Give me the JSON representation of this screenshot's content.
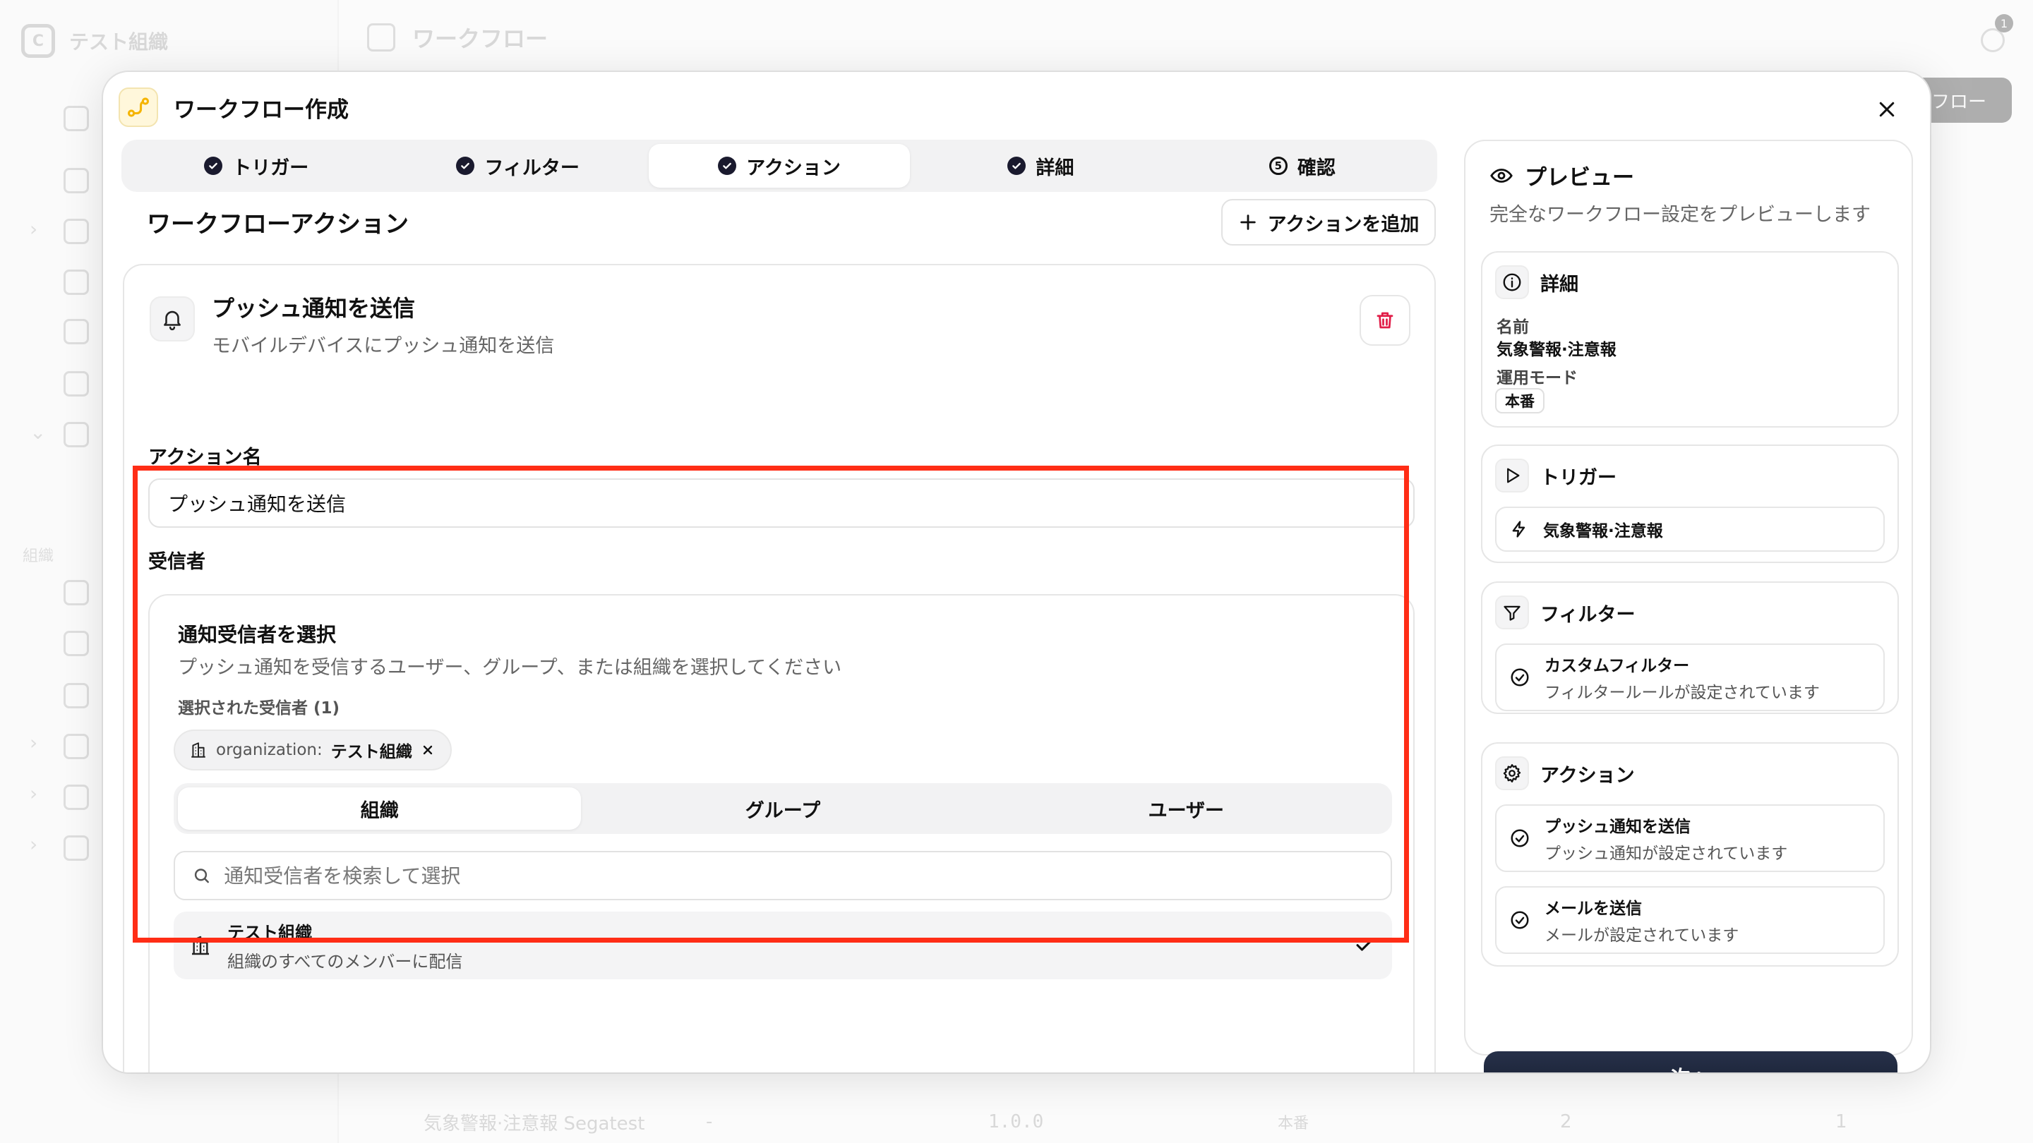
{
  "background": {
    "org_name": "テスト組織",
    "header_title": "ワークフロー",
    "section_label": "組織",
    "top_button": "フロー",
    "badge_count": "1",
    "row": {
      "name": "気象警報·注意報 Segatest",
      "dash": "-",
      "version": "1.0.0",
      "mode": "本番",
      "count_a": "2",
      "count_b": "1"
    }
  },
  "modal": {
    "title": "ワークフロー作成",
    "steps": [
      {
        "label": "トリガー",
        "state": "done"
      },
      {
        "label": "フィルター",
        "state": "done"
      },
      {
        "label": "アクション",
        "state": "done",
        "active": true
      },
      {
        "label": "詳細",
        "state": "done"
      },
      {
        "label": "確認",
        "number": "5"
      }
    ]
  },
  "actions_section": {
    "title": "ワークフローアクション",
    "add_button": "アクションを追加",
    "action": {
      "title": "プッシュ通知を送信",
      "description": "モバイルデバイスにプッシュ通知を送信",
      "name_label": "アクション名",
      "name_value": "プッシュ通知を送信",
      "recipients_label": "受信者",
      "recipients": {
        "title": "通知受信者を選択",
        "description": "プッシュ通知を受信するユーザー、グループ、または組織を選択してください",
        "selected_label": "選択された受信者 (1)",
        "chip_type": "organization:",
        "chip_name": "テスト組織",
        "tabs": [
          "組織",
          "グループ",
          "ユーザー"
        ],
        "active_tab": "組織",
        "search_placeholder": "通知受信者を検索して選択",
        "result": {
          "title": "テスト組織",
          "description": "組織のすべてのメンバーに配信",
          "selected": true
        }
      }
    }
  },
  "preview": {
    "title": "プレビュー",
    "subtitle": "完全なワークフロー設定をプレビューします",
    "details": {
      "title": "詳細",
      "name_label": "名前",
      "name_value": "気象警報·注意報",
      "mode_label": "運用モード",
      "mode_value": "本番"
    },
    "trigger": {
      "title": "トリガー",
      "item": "気象警報·注意報"
    },
    "filter": {
      "title": "フィルター",
      "item_title": "カスタムフィルター",
      "item_desc": "フィルタールールが設定されています"
    },
    "actions": {
      "title": "アクション",
      "items": [
        {
          "title": "プッシュ通知を送信",
          "desc": "プッシュ通知が設定されています"
        },
        {
          "title": "メールを送信",
          "desc": "メールが設定されています"
        }
      ]
    },
    "next_button": "次へ"
  },
  "colors": {
    "highlight": "#ff2d16",
    "primary_dark": "#1a1a2e",
    "delete_red": "#e11d48",
    "accent_yellow": "#f5b400"
  }
}
